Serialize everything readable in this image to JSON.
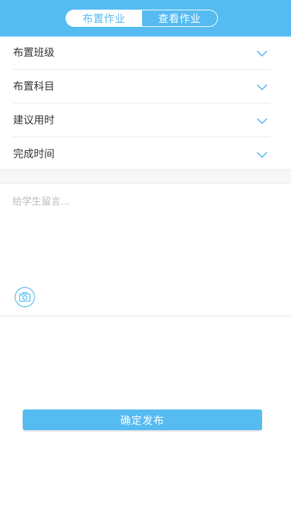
{
  "header": {
    "tabs": [
      {
        "label": "布置作业",
        "active": true
      },
      {
        "label": "查看作业",
        "active": false
      }
    ]
  },
  "form": {
    "rows": [
      {
        "label": "布置班级",
        "icon": "chevron-down-icon"
      },
      {
        "label": "布置科目",
        "icon": "chevron-down-icon"
      },
      {
        "label": "建议用时",
        "icon": "chevron-down-icon"
      },
      {
        "label": "完成时间",
        "icon": "chevron-down-icon"
      }
    ]
  },
  "message": {
    "placeholder": "给学生留言...",
    "value": "",
    "camera_icon": "camera-icon"
  },
  "submit": {
    "label": "确定发布"
  },
  "colors": {
    "accent": "#55bbf1",
    "text": "#333333",
    "placeholder": "#bbbbbb",
    "divider": "#e9e9e9"
  }
}
